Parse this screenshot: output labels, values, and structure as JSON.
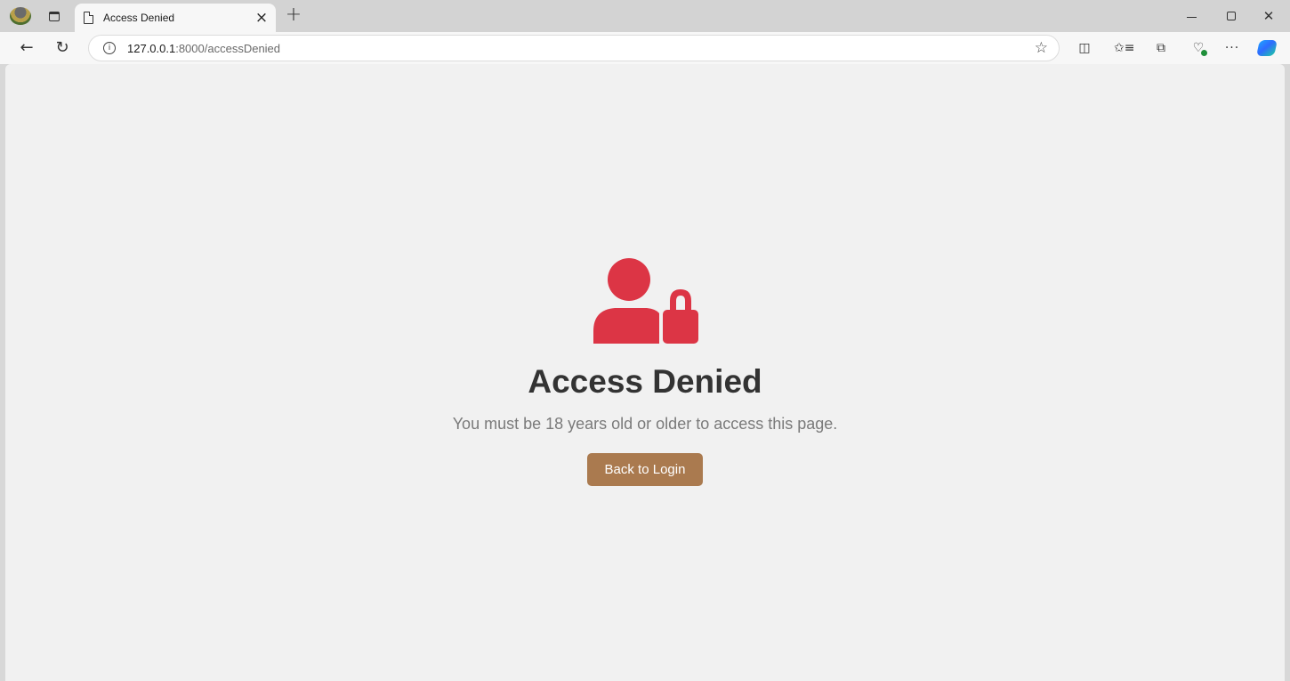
{
  "browser": {
    "tab": {
      "title": "Access Denied",
      "close_glyph": "×"
    },
    "new_tab_glyph": "+",
    "address": {
      "host": "127.0.0.1",
      "path": ":8000/accessDenied",
      "info_glyph": "i"
    },
    "icons": {
      "profile": "profile-avatar-icon",
      "tab_actions": "tab-actions-icon",
      "back": "back-arrow-icon",
      "refresh": "refresh-icon",
      "favorite": "star-icon",
      "split_screen": "split-screen-icon",
      "favorites": "favorites-icon",
      "collections": "collections-icon",
      "performance": "browser-essentials-icon",
      "more": "more-icon",
      "copilot": "copilot-icon"
    },
    "glyphs": {
      "back": "←",
      "refresh": "↻",
      "star": "☆",
      "split": "◫",
      "favorites": "✩≡",
      "collections": "⧉",
      "performance": "♡",
      "more": "···",
      "close": "✕"
    }
  },
  "page": {
    "heading": "Access Denied",
    "message": "You must be 18 years old or older to access this page.",
    "button_label": "Back to Login",
    "icon": "user-lock-icon"
  },
  "colors": {
    "accent_red": "#dc3545",
    "button_brown": "#aa7a4f",
    "page_background": "#f1f1f1",
    "heading_text": "#333333",
    "message_text": "#7a7a7a"
  }
}
